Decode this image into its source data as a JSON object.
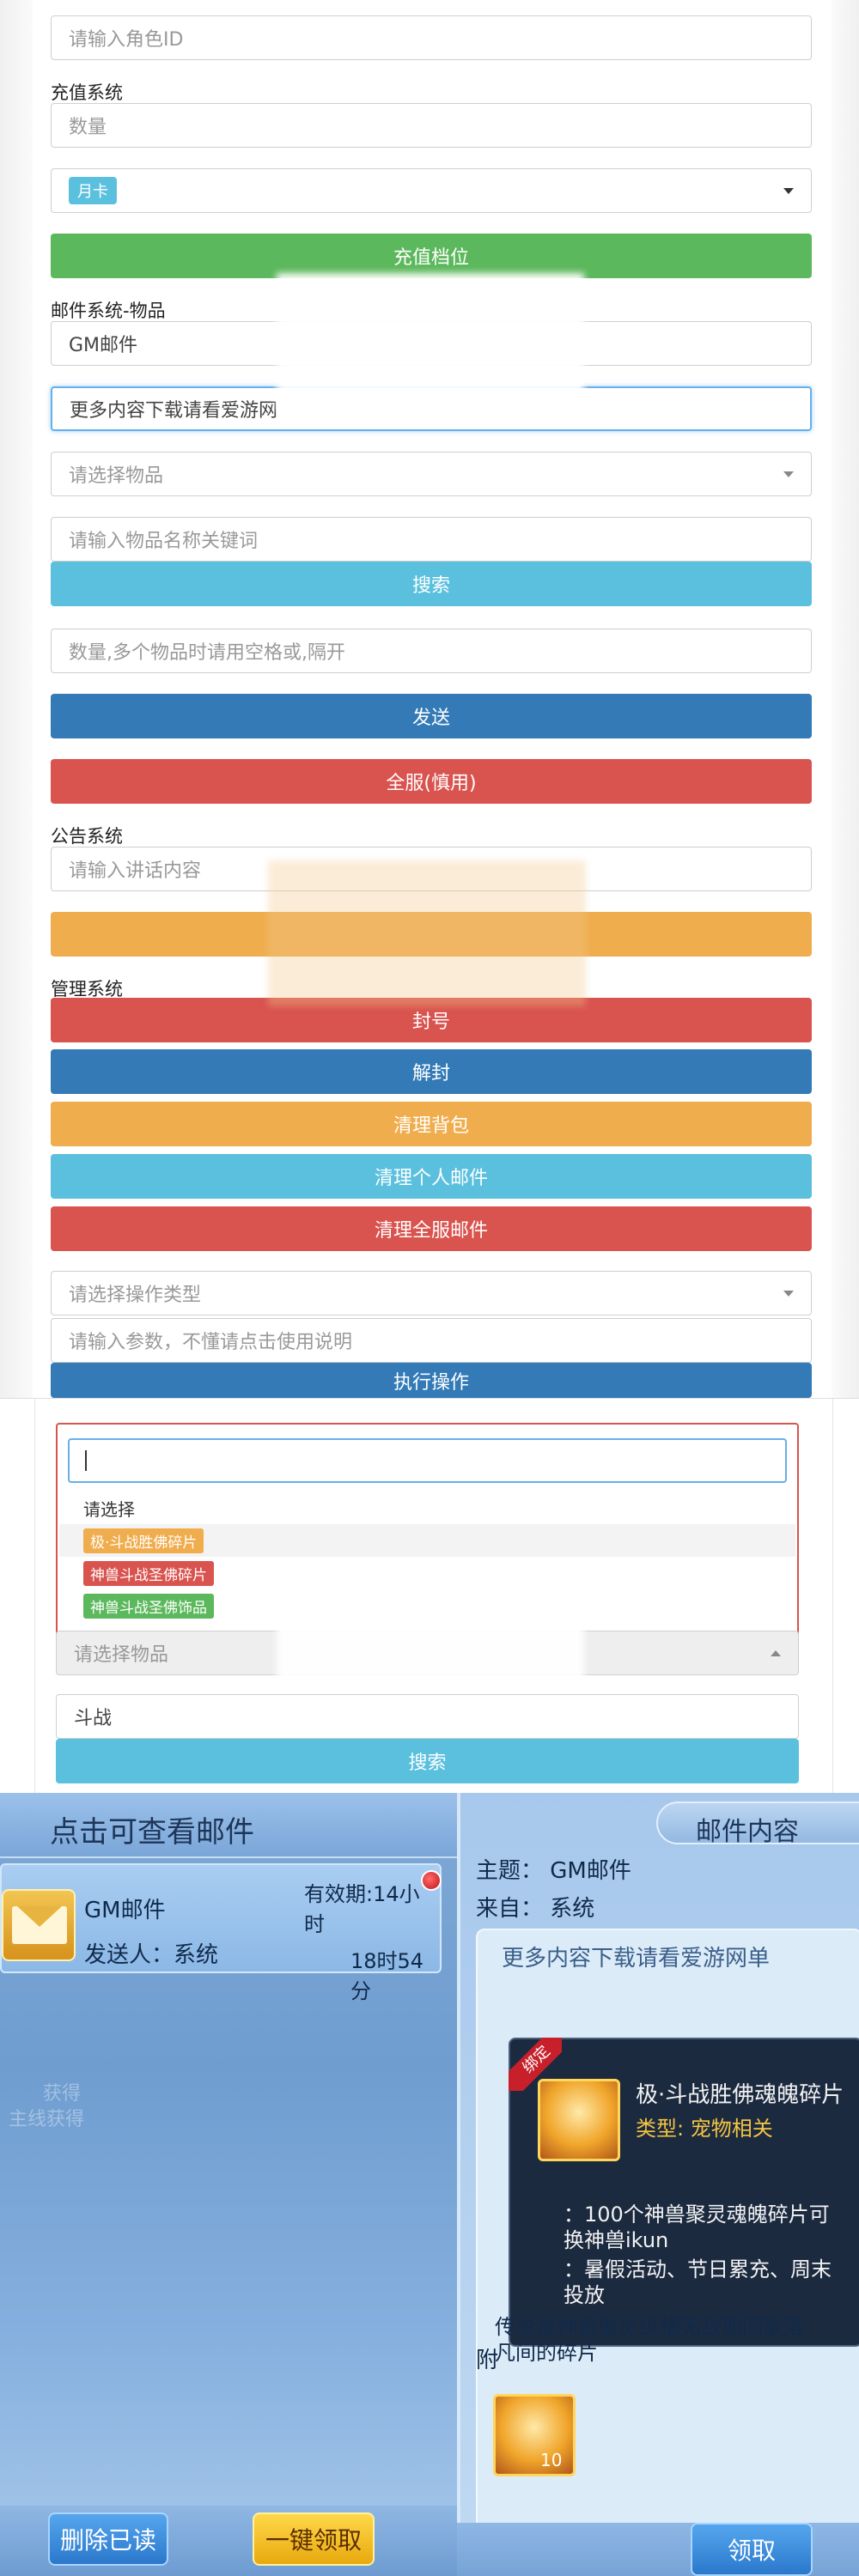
{
  "gm_form": {
    "role_id_placeholder": "请输入角色ID",
    "recharge_label": "充值系统",
    "amount_placeholder": "数量",
    "card_type_selected": "月卡",
    "recharge_button": "充值档位",
    "mail_label": "邮件系统-物品",
    "mail_title_value": "GM邮件",
    "mail_body_value": "更多内容下载请看爱游网",
    "item_select_placeholder": "请选择物品",
    "item_keyword_placeholder": "请输入物品名称关键词",
    "search_button": "搜索",
    "quantity_placeholder": "数量,多个物品时请用空格或,隔开",
    "send_button": "发送",
    "all_server_button": "全服(慎用)",
    "notice_label": "公告系统",
    "notice_placeholder": "请输入讲话内容",
    "manage_label": "管理系统",
    "ban_button": "封号",
    "unban_button": "解封",
    "clear_bag_button": "清理背包",
    "clear_personal_mail_button": "清理个人邮件",
    "clear_all_mail_button": "清理全服邮件",
    "operation_type_placeholder": "请选择操作类型",
    "param_placeholder": "请输入参数，不懂请点击使用说明",
    "execute_button": "执行操作"
  },
  "item_dropdown": {
    "first_option": "请选择",
    "options": [
      {
        "label": "极·斗战胜佛碎片",
        "color": "#f0ad4e"
      },
      {
        "label": "神兽斗战圣佛碎片",
        "color": "#d9534f"
      },
      {
        "label": "神兽斗战圣佛饰品",
        "color": "#5cb85c"
      }
    ],
    "select_placeholder": "请选择物品",
    "keyword_value": "斗战",
    "search_button": "搜索"
  },
  "game_mail": {
    "list_title": "点击可查看邮件",
    "mail_name": "GM邮件",
    "validity": "有效期:14小时",
    "sender": "发送人：系统",
    "time_left": "18时54分",
    "ghost_text_1": "获得",
    "ghost_text_2": "主线获得",
    "delete_read_button": "删除已读",
    "claim_all_button": "一键领取",
    "content_title": "邮件内容",
    "subject": "主题：  GM邮件",
    "from": "来自：  系统",
    "body_text": "更多内容下载请看爱游网单",
    "tooltip": {
      "bound_tag": "绑定",
      "item_name": "极·斗战胜佛魂魄碎片",
      "type_line": "类型: 宠物相关",
      "desc_1": "：100个神兽聚灵魂魄碎片可",
      "desc_2": "换神兽ikun",
      "desc_3": "：暑假活动、节日累充、周末",
      "desc_4": "投放",
      "lore_1": "传说是神兽聚灵纵横无敌期间散落",
      "lore_2": "凡间的碎片"
    },
    "attach_label": "附",
    "item_count": "10",
    "claim_button": "领取"
  },
  "colors": {
    "bootstrap_green": "#5cb85c",
    "bootstrap_blue": "#337ab7",
    "bootstrap_info": "#5bc0de",
    "bootstrap_red": "#d9534f",
    "bootstrap_orange": "#f0ad4e"
  }
}
